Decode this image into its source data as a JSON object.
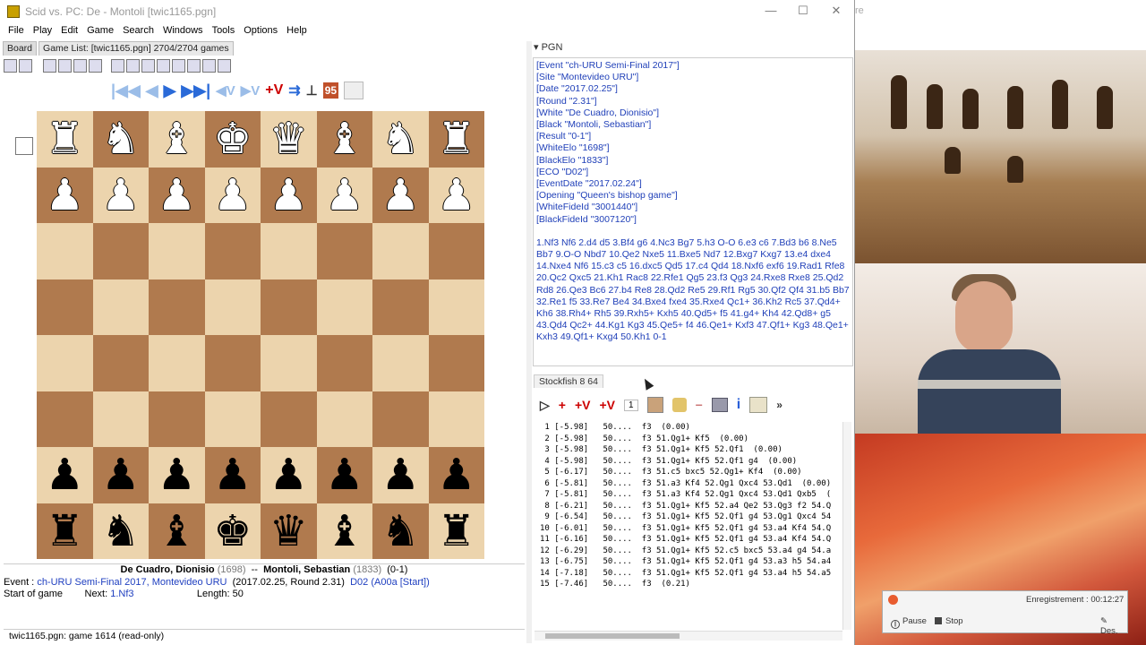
{
  "window": {
    "title": "Scid vs. PC: De - Montoli [twic1165.pgn]",
    "minimize": "—",
    "maximize": "☐",
    "close": "✕"
  },
  "menu": [
    "File",
    "Play",
    "Edit",
    "Game",
    "Search",
    "Windows",
    "Tools",
    "Options",
    "Help"
  ],
  "tabs": {
    "board": "Board",
    "gamelist": "Game List: [twic1165.pgn] 2704/2704 games",
    "pgn": "▾ PGN"
  },
  "nav": {
    "first": "|◀◀",
    "back": "◀",
    "forward": "▶",
    "last": "▶▶|",
    "var_back": "◀V",
    "var_enter": "▶V",
    "add_var": "+V",
    "number": "95"
  },
  "board": {
    "rows": [
      [
        "♜",
        "♞",
        "♝",
        "♚",
        "♛",
        "♝",
        "♞",
        "♜"
      ],
      [
        "♟",
        "♟",
        "♟",
        "♟",
        "♟",
        "♟",
        "♟",
        "♟"
      ],
      [
        "",
        "",
        "",
        "",
        "",
        "",
        "",
        ""
      ],
      [
        "",
        "",
        "",
        "",
        "",
        "",
        "",
        ""
      ],
      [
        "",
        "",
        "",
        "",
        "",
        "",
        "",
        ""
      ],
      [
        "",
        "",
        "",
        "",
        "",
        "",
        "",
        ""
      ],
      [
        "♟",
        "♟",
        "♟",
        "♟",
        "♟",
        "♟",
        "♟",
        "♟"
      ],
      [
        "♜",
        "♞",
        "♝",
        "♚",
        "♛",
        "♝",
        "♞",
        "♜"
      ]
    ],
    "top_color": "white",
    "bottom_color": "black"
  },
  "game_info": {
    "white": "De Cuadro, Dionisio",
    "white_elo": "(1698)",
    "sep": "--",
    "black": "Montoli, Sebastian",
    "black_elo": "(1833)",
    "result": "(0-1)",
    "event_label": "Event :",
    "event": "ch-URU Semi-Final 2017,",
    "site": "Montevideo URU",
    "date_round": "(2017.02.25, Round 2.31)",
    "eco": "D02",
    "eco_link": "(A00a [Start])",
    "start": "Start of game",
    "next_label": "Next:",
    "next": "1.Nf3",
    "length_label": "Length:",
    "length": "50"
  },
  "status": "twic1165.pgn: game  1614   (read-only)",
  "pgn": {
    "tags": [
      "[Event \"ch-URU Semi-Final 2017\"]",
      "[Site \"Montevideo URU\"]",
      "[Date \"2017.02.25\"]",
      "[Round \"2.31\"]",
      "[White \"De Cuadro, Dionisio\"]",
      "[Black \"Montoli, Sebastian\"]",
      "[Result \"0-1\"]",
      "[WhiteElo \"1698\"]",
      "[BlackElo \"1833\"]",
      "[ECO \"D02\"]",
      "[EventDate \"2017.02.24\"]",
      "[Opening \"Queen's bishop game\"]",
      "[WhiteFideId \"3001440\"]",
      "[BlackFideId \"3007120\"]"
    ],
    "moves": "1.Nf3 Nf6 2.d4 d5 3.Bf4 g6 4.Nc3 Bg7 5.h3 O-O 6.e3 c6 7.Bd3 b6 8.Ne5 Bb7 9.O-O Nbd7 10.Qe2 Nxe5 11.Bxe5 Nd7 12.Bxg7 Kxg7 13.e4 dxe4 14.Nxe4 Nf6 15.c3 c5 16.dxc5 Qd5 17.c4 Qd4 18.Nxf6 exf6 19.Rad1 Rfe8 20.Qc2 Qxc5 21.Kh1 Rac8 22.Rfe1 Qg5 23.f3 Qg3 24.Rxe8 Rxe8 25.Qd2 Rd8 26.Qe3 Bc6 27.b4 Re8 28.Qd2 Re5 29.Rf1 Rg5 30.Qf2 Qf4 31.b5 Bb7 32.Re1 f5 33.Re7 Be4 34.Bxe4 fxe4 35.Rxe4 Qc1+ 36.Kh2 Rc5 37.Qd4+ Kh6 38.Rh4+ Rh5 39.Rxh5+ Kxh5 40.Qd5+ f5 41.g4+ Kh4 42.Qd8+ g5 43.Qd4 Qc2+ 44.Kg1 Kg3 45.Qe5+ f4 46.Qe1+ Kxf3 47.Qf1+ Kg3 48.Qe1+ Kxh3 49.Qf1+ Kxg4 50.Kh1 0-1"
  },
  "engine": {
    "tab": "Stockfish 8 64",
    "lines": [
      " 1 [-5.98]   50....  f3  (0.00)",
      " 2 [-5.98]   50....  f3 51.Qg1+ Kf5  (0.00)",
      " 3 [-5.98]   50....  f3 51.Qg1+ Kf5 52.Qf1  (0.00)",
      " 4 [-5.98]   50....  f3 51.Qg1+ Kf5 52.Qf1 g4  (0.00)",
      " 5 [-6.17]   50....  f3 51.c5 bxc5 52.Qg1+ Kf4  (0.00)",
      " 6 [-5.81]   50....  f3 51.a3 Kf4 52.Qg1 Qxc4 53.Qd1  (0.00)",
      " 7 [-5.81]   50....  f3 51.a3 Kf4 52.Qg1 Qxc4 53.Qd1 Qxb5  (",
      " 8 [-6.21]   50....  f3 51.Qg1+ Kf5 52.a4 Qe2 53.Qg3 f2 54.Q",
      " 9 [-6.54]   50....  f3 51.Qg1+ Kf5 52.Qf1 g4 53.Qg1 Qxc4 54",
      "10 [-6.01]   50....  f3 51.Qg1+ Kf5 52.Qf1 g4 53.a4 Kf4 54.Q",
      "11 [-6.16]   50....  f3 51.Qg1+ Kf5 52.Qf1 g4 53.a4 Kf4 54.Q",
      "12 [-6.29]   50....  f3 51.Qg1+ Kf5 52.c5 bxc5 53.a4 g4 54.a",
      "13 [-6.75]   50....  f3 51.Qg1+ Kf5 52.Qf1 g4 53.a3 h5 54.a4",
      "14 [-7.18]   50....  f3 51.Qg1+ Kf5 52.Qf1 g4 53.a4 h5 54.a5",
      "15 [-7.46]   50....  f3  (0.21)"
    ],
    "btn_play": "▷",
    "btn_add": "+",
    "btn_addvar": "+V",
    "btn_addallvar": "+V",
    "pv_count": "1",
    "more": "»"
  },
  "right_bg_title": "re",
  "recorder": {
    "label": "Enregistrement : 00:12:27",
    "pause": "Pause",
    "stop": "Stop",
    "draw": "Des."
  }
}
